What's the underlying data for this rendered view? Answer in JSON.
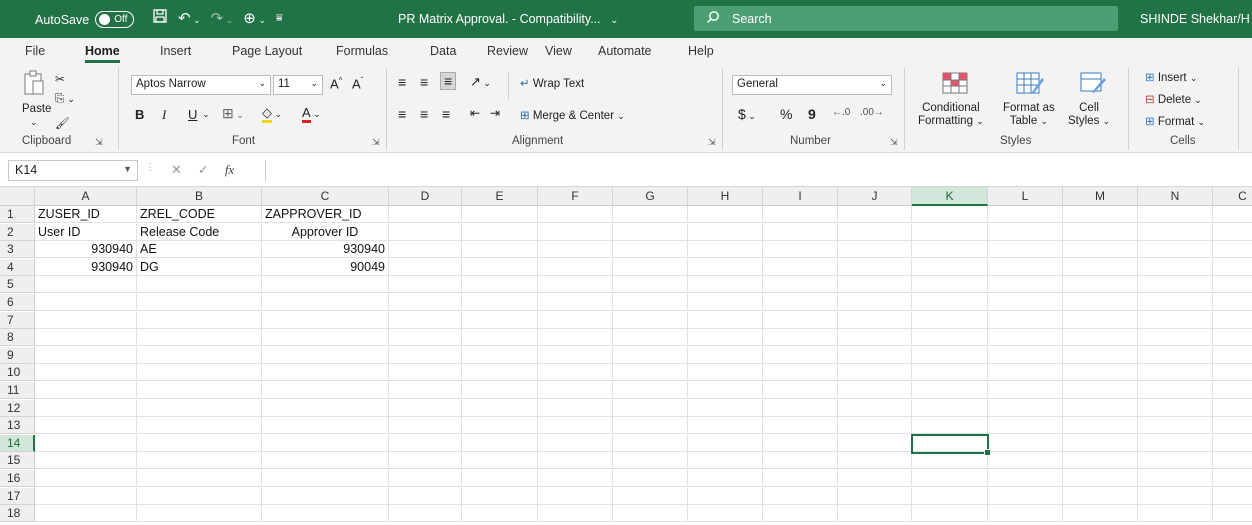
{
  "titlebar": {
    "autosave_label": "AutoSave",
    "autosave_state": "Off",
    "doc_title": "PR Matrix Approval. - Compatibility...",
    "search_placeholder": "Search",
    "user": "SHINDE Shekhar/H"
  },
  "tabs": [
    "File",
    "Home",
    "Insert",
    "Page Layout",
    "Formulas",
    "Data",
    "Review",
    "View",
    "Automate",
    "Help"
  ],
  "active_tab": "Home",
  "ribbon": {
    "clipboard": {
      "paste": "Paste",
      "label": "Clipboard"
    },
    "font": {
      "font_name": "Aptos Narrow",
      "font_size": "11",
      "bold": "B",
      "italic": "I",
      "underline": "U",
      "label": "Font"
    },
    "alignment": {
      "wrap_text": "Wrap Text",
      "merge_center": "Merge & Center",
      "label": "Alignment"
    },
    "number": {
      "format": "General",
      "currency": "$",
      "percent": "%",
      "comma": "9",
      "label": "Number"
    },
    "styles": {
      "conditional": "Conditional",
      "formatting": "Formatting",
      "format_as": "Format as",
      "table": "Table",
      "cell": "Cell",
      "styles_btn": "Styles",
      "label": "Styles"
    },
    "cells": {
      "insert": "Insert",
      "delete": "Delete",
      "format": "Format",
      "label": "Cells"
    }
  },
  "formula_bar": {
    "name_box": "K14",
    "fx": "fx",
    "value": ""
  },
  "grid": {
    "columns": [
      "A",
      "B",
      "C",
      "D",
      "E",
      "F",
      "G",
      "H",
      "I",
      "J",
      "K",
      "L",
      "M",
      "N",
      "C"
    ],
    "rows": [
      "1",
      "2",
      "3",
      "4",
      "5",
      "6",
      "7",
      "8",
      "9",
      "10",
      "11",
      "12",
      "13",
      "14",
      "15",
      "16",
      "17",
      "18"
    ],
    "selected_column": "K",
    "selected_row": "14",
    "cells": {
      "A1": "ZUSER_ID",
      "B1": "ZREL_CODE",
      "C1": "ZAPPROVER_ID",
      "A2": "User ID",
      "B2": "Release Code",
      "C2": "Approver ID",
      "A3": "930940",
      "B3": "AE",
      "C3": "930940",
      "A4": "930940",
      "B4": "DG",
      "C4": "90049"
    }
  },
  "colors": {
    "accent": "#217346",
    "search_bg": "#4d9f73",
    "selected_header": "#d3e6da"
  }
}
